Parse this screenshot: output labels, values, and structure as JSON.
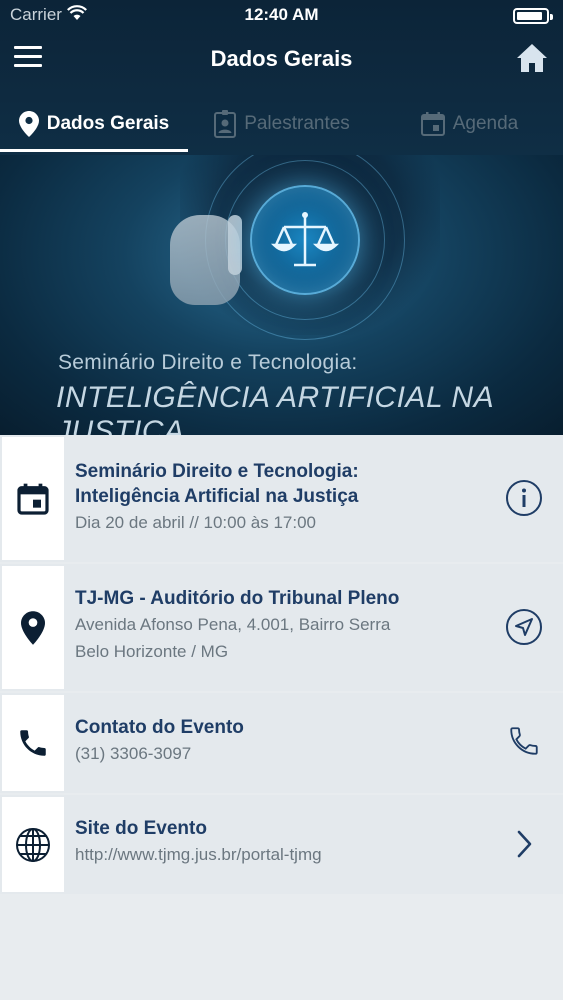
{
  "status_bar": {
    "carrier": "Carrier",
    "time": "12:40 AM",
    "battery_level": 0.9
  },
  "nav": {
    "title": "Dados Gerais",
    "menu_icon": "hamburger-icon",
    "home_icon": "home-icon"
  },
  "tabs": [
    {
      "label": "Dados Gerais",
      "icon": "location-pin-icon",
      "active": true
    },
    {
      "label": "Palestrantes",
      "icon": "badge-icon",
      "active": false
    },
    {
      "label": "Agenda",
      "icon": "calendar-icon",
      "active": false
    }
  ],
  "banner": {
    "subtitle": "Seminário Direito e Tecnologia:",
    "headline": "INTELIGÊNCIA ARTIFICIAL NA JUSTIÇA",
    "icon": "scales-of-justice-icon"
  },
  "cards": [
    {
      "icon": "calendar-icon",
      "title_lines": [
        "Seminário Direito e Tecnologia:",
        "Inteligência Artificial na Justiça"
      ],
      "lines": [
        "Dia 20 de abril // 10:00 às 17:00"
      ],
      "action_icon": "info-icon"
    },
    {
      "icon": "location-pin-icon",
      "title_lines": [
        "TJ-MG - Auditório do Tribunal Pleno"
      ],
      "lines": [
        "Avenida Afonso Pena, 4.001, Bairro Serra",
        "Belo Horizonte / MG"
      ],
      "action_icon": "navigation-arrow-icon"
    },
    {
      "icon": "phone-icon",
      "title_lines": [
        "Contato do Evento"
      ],
      "lines": [
        "(31) 3306-3097"
      ],
      "action_icon": "phone-outline-icon"
    },
    {
      "icon": "globe-icon",
      "title_lines": [
        "Site do Evento"
      ],
      "lines": [
        "http://www.tjmg.jus.br/portal-tjmg"
      ],
      "action_icon": "chevron-right-icon"
    }
  ],
  "colors": {
    "header_bg": "#0f2e45",
    "title_text": "#1f3d66",
    "secondary_text": "#6b7780",
    "inactive_tab": "#566a78",
    "page_bg": "#e8ecef"
  }
}
